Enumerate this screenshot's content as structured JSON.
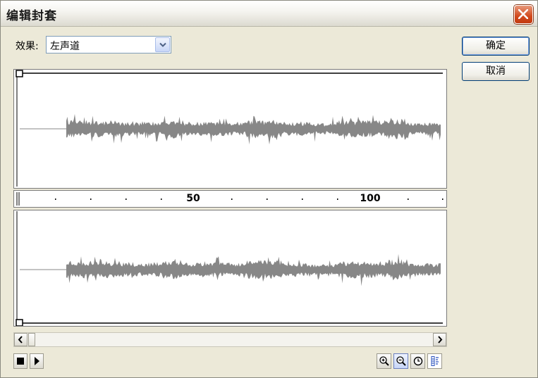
{
  "window": {
    "title": "编辑封套"
  },
  "effect": {
    "label": "效果:",
    "value": "左声道"
  },
  "buttons": {
    "ok": "确定",
    "cancel": "取消"
  },
  "ruler": {
    "labels": [
      "50",
      "100"
    ]
  },
  "icons": {
    "close": "close-icon",
    "dropdown": "chevron-down-icon",
    "stop": "stop-icon",
    "play": "play-icon",
    "zoom_in": "zoom-in-icon",
    "zoom_out": "zoom-out-icon",
    "time": "clock-icon",
    "frames": "frames-icon"
  },
  "colors": {
    "waveform": "#878787",
    "envelope": "#000000",
    "close_button": "#d24a1d"
  }
}
